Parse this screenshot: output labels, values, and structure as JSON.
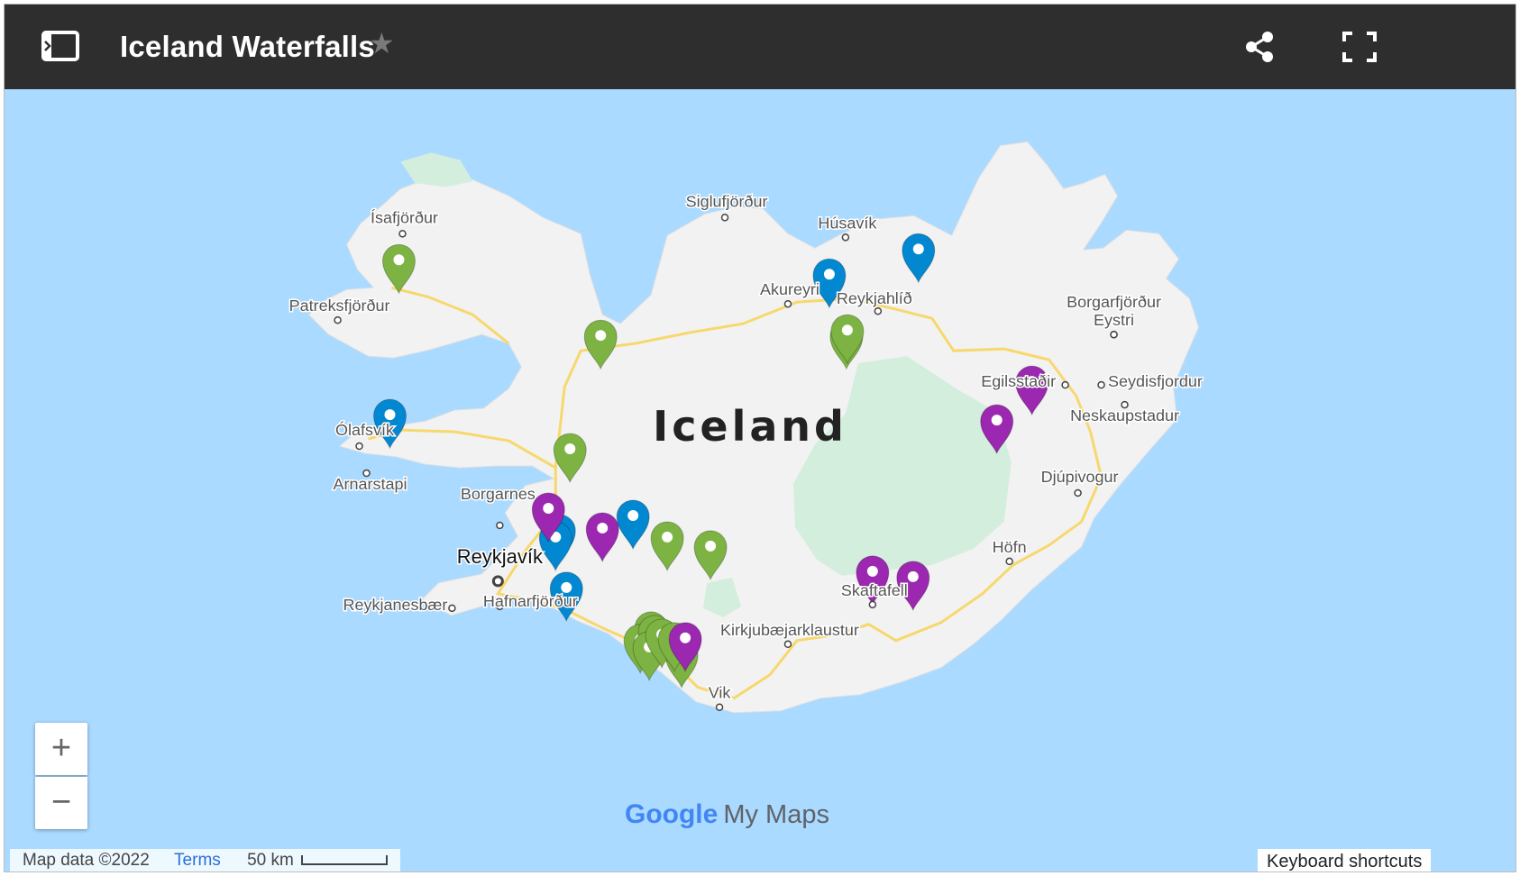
{
  "header": {
    "title": "Iceland Waterfalls",
    "sidebar_icon": "panel-toggle-icon",
    "star_icon": "star-icon",
    "share_icon": "share-icon",
    "fullscreen_icon": "fullscreen-icon"
  },
  "map": {
    "country_label": "Iceland",
    "places": [
      {
        "name": "Ísafjörður"
      },
      {
        "name": "Patreksfjörður"
      },
      {
        "name": "Ólafsvík"
      },
      {
        "name": "Arnarstapi"
      },
      {
        "name": "Borgarnes"
      },
      {
        "name": "Reykjavík"
      },
      {
        "name": "Reykjanesbær"
      },
      {
        "name": "Hafnarfjörður"
      },
      {
        "name": "Siglufjörður"
      },
      {
        "name": "Húsavík"
      },
      {
        "name": "Akureyri"
      },
      {
        "name": "Reykjahlíð"
      },
      {
        "name": "Borgarfjörður"
      },
      {
        "name": "Eystri"
      },
      {
        "name": "Egilsstaðir"
      },
      {
        "name": "Seydisfjordur"
      },
      {
        "name": "Neskaupstadur"
      },
      {
        "name": "Djúpivogur"
      },
      {
        "name": "Höfn"
      },
      {
        "name": "Skaftafell"
      },
      {
        "name": "Kirkjubæjarklaustur"
      },
      {
        "name": "Vik"
      }
    ],
    "marker_colors": {
      "green": "#7cb342",
      "blue": "#0288d1",
      "purple": "#9c27b0"
    },
    "marker_counts": {
      "green": 14,
      "blue": 7,
      "purple": 7
    },
    "water_color": "#aadaff",
    "land_color": "#f2f2f2",
    "park_color": "#d4eedd",
    "road_color": "#f7d86d"
  },
  "controls": {
    "zoom_in": "+",
    "zoom_out": "−"
  },
  "footer": {
    "map_data": "Map data ©2022",
    "terms": "Terms",
    "scale": "50 km",
    "keyboard_shortcuts": "Keyboard shortcuts",
    "brand_google": "Google",
    "brand_mymaps": "My Maps"
  }
}
